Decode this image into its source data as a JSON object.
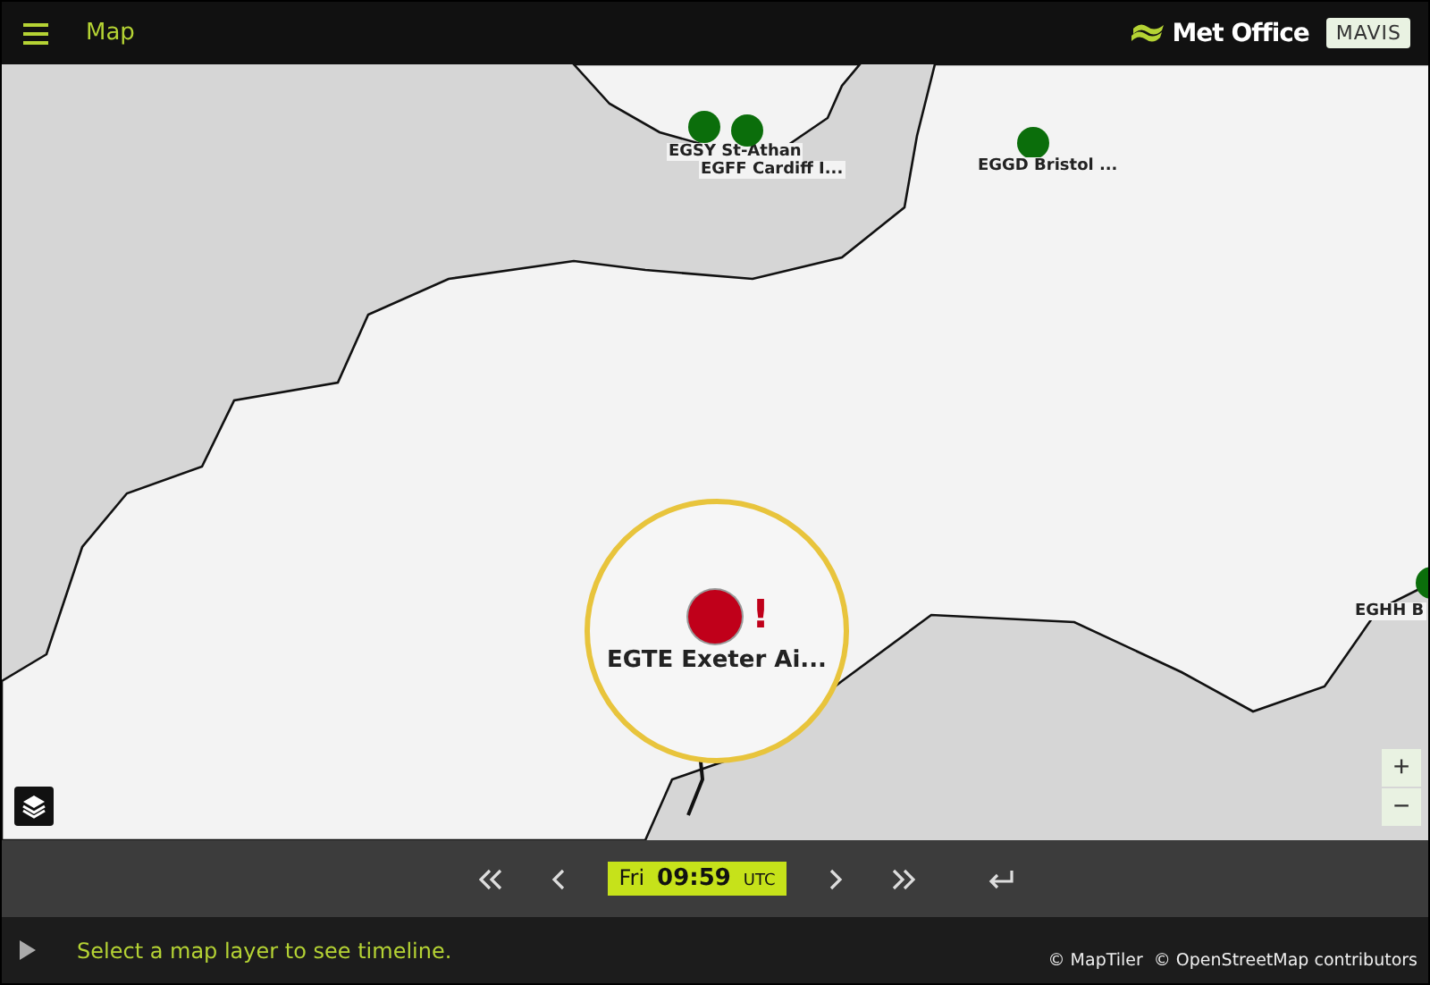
{
  "header": {
    "title": "Map",
    "brand": "Met Office",
    "app_badge": "MAVIS"
  },
  "map": {
    "stations": [
      {
        "label": "EGSY St-Athan",
        "color": "#0b6e0b",
        "selected": false
      },
      {
        "label": "EGFF Cardiff I...",
        "color": "#0b6e0b",
        "selected": false
      },
      {
        "label": "EGGD Bristol ...",
        "color": "#0b6e0b",
        "selected": false
      },
      {
        "label": "EGHH B",
        "color": "#0b6e0b",
        "selected": false
      },
      {
        "label": "EGTE Exeter Ai...",
        "color": "#c0001a",
        "selected": true,
        "badge": "!"
      }
    ],
    "zoom_in": "+",
    "zoom_out": "−"
  },
  "timebar": {
    "day": "Fri",
    "time": "09:59",
    "zone": "UTC"
  },
  "footer": {
    "message": "Select a map layer to see timeline.",
    "attributions": [
      "© MapTiler",
      "© OpenStreetMap contributors"
    ]
  }
}
